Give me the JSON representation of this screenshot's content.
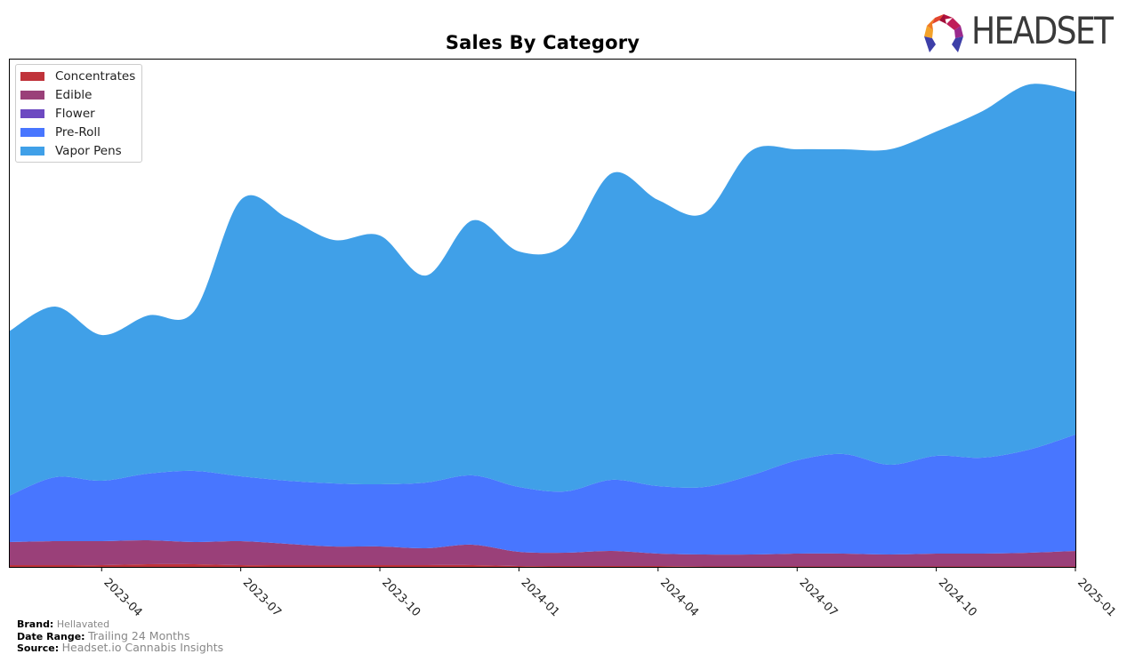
{
  "brand_logo": {
    "text": "HEADSET"
  },
  "footer": {
    "brand_key": "Brand:",
    "brand_value": "Hellavated",
    "date_range_key": "Date Range:",
    "date_range_value": "Trailing 24 Months",
    "source_key": "Source:",
    "source_value": "Headset.io Cannabis Insights"
  },
  "chart_data": {
    "type": "area",
    "stacked": true,
    "smoothed": true,
    "title": "Sales By Category",
    "xlabel": "",
    "ylabel": "",
    "y_ticks_shown": false,
    "grid": false,
    "legend_position": "top-left",
    "x": [
      "2023-02",
      "2023-03",
      "2023-04",
      "2023-05",
      "2023-06",
      "2023-07",
      "2023-08",
      "2023-09",
      "2023-10",
      "2023-11",
      "2023-12",
      "2024-01",
      "2024-02",
      "2024-03",
      "2024-04",
      "2024-05",
      "2024-06",
      "2024-07",
      "2024-08",
      "2024-09",
      "2024-10",
      "2024-11",
      "2024-12",
      "2025-01"
    ],
    "x_tick_labels": [
      "2023-04",
      "2023-07",
      "2023-10",
      "2024-01",
      "2024-04",
      "2024-07",
      "2024-10",
      "2025-01"
    ],
    "ylim": [
      0,
      572
    ],
    "series": [
      {
        "name": "Concentrates",
        "color": "#c0333a",
        "values": [
          2,
          2,
          2,
          3,
          3,
          2,
          2,
          2,
          2,
          2,
          2,
          1,
          1,
          1,
          1,
          0.5,
          0.5,
          0.5,
          0.5,
          0.5,
          0.5,
          0.5,
          0.5,
          0.5
        ]
      },
      {
        "name": "Edible",
        "color": "#9a4079",
        "values": [
          26,
          27,
          27,
          27,
          25,
          27,
          24,
          21,
          21,
          19,
          23,
          16,
          15,
          17,
          14,
          13.5,
          13.5,
          14.5,
          14.5,
          13.5,
          14.5,
          14.5,
          15.5,
          17.5
        ]
      },
      {
        "name": "Flower",
        "color": "#6d49c1",
        "values": [
          0,
          0,
          0,
          0,
          0,
          0,
          0,
          0,
          0,
          0,
          0,
          0,
          0,
          0,
          0,
          0,
          0,
          0,
          0,
          0,
          0,
          0,
          0,
          0
        ]
      },
      {
        "name": "Pre-Roll",
        "color": "#4876ff",
        "values": [
          52,
          72,
          68,
          75,
          80,
          73,
          71,
          71,
          70,
          74,
          78,
          73,
          69,
          80,
          76,
          76,
          89,
          105,
          112,
          101,
          110,
          108,
          116,
          131
        ]
      },
      {
        "name": "Vapor Pens",
        "color": "#40a0e8",
        "values": [
          185,
          192,
          164,
          178,
          180,
          311,
          296,
          274,
          280,
          233,
          287,
          265,
          278,
          345,
          322,
          308,
          365,
          350,
          343,
          355,
          365,
          390,
          411,
          386
        ]
      }
    ]
  }
}
